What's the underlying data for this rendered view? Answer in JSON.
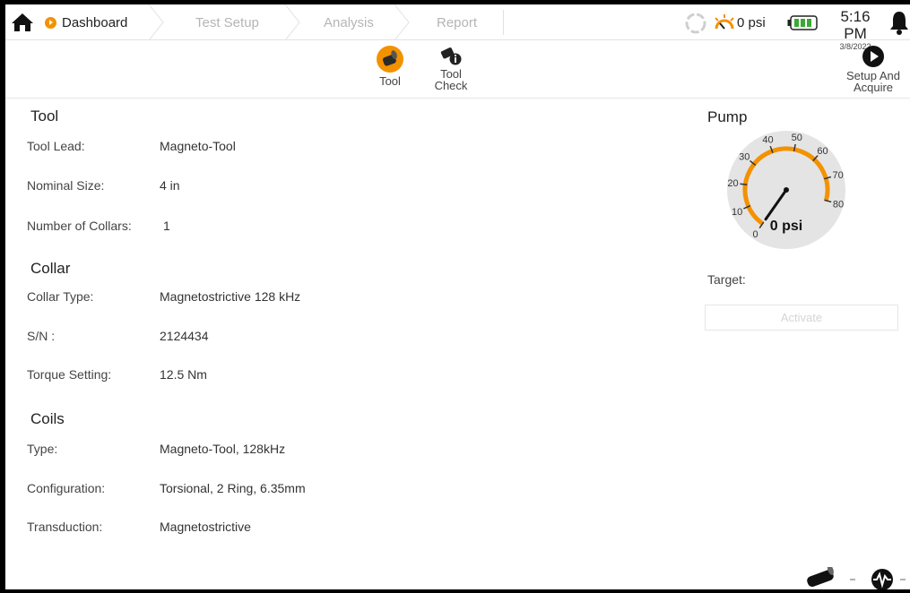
{
  "breadcrumbs": [
    {
      "label": "Dashboard"
    },
    {
      "label": "Test Setup"
    },
    {
      "label": "Analysis"
    },
    {
      "label": "Report"
    }
  ],
  "status": {
    "pressure": "0 psi",
    "time": "5:16 PM",
    "date": "3/8/2022"
  },
  "toolbar": {
    "tool_label": "Tool",
    "tool_check_line1": "Tool",
    "tool_check_line2": "Check",
    "setup_line1": "Setup And",
    "setup_line2": "Acquire"
  },
  "tool": {
    "title": "Tool",
    "rows": [
      {
        "label": "Tool Lead:",
        "value": "Magneto-Tool"
      },
      {
        "label": "Nominal Size:",
        "value": "4 in"
      },
      {
        "label": "Number of Collars:",
        "value": "1"
      }
    ]
  },
  "collar": {
    "title": "Collar",
    "rows": [
      {
        "label": "Collar Type:",
        "value": "Magnetostrictive 128 kHz"
      },
      {
        "label": "S/N :",
        "value": "2124434"
      },
      {
        "label": "Torque Setting:",
        "value": "12.5 Nm"
      }
    ]
  },
  "coils": {
    "title": "Coils",
    "rows": [
      {
        "label": "Type:",
        "value": "Magneto-Tool, 128kHz"
      },
      {
        "label": "Configuration:",
        "value": "Torsional, 2 Ring, 6.35mm"
      },
      {
        "label": "Transduction:",
        "value": "Magnetostrictive"
      }
    ]
  },
  "pump": {
    "title": "Pump",
    "gauge_value": 0,
    "gauge_readout": "0 psi",
    "ticks": [
      "0",
      "10",
      "20",
      "30",
      "40",
      "50",
      "60",
      "70",
      "80"
    ],
    "target_label": "Target:",
    "activate_label": "Activate"
  },
  "colors": {
    "accent": "#f39200",
    "gauge_face": "#e4e4e4"
  }
}
